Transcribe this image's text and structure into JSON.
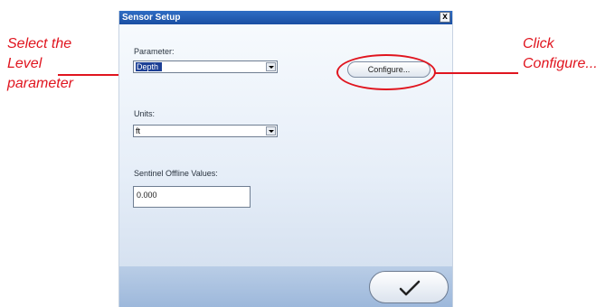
{
  "annotations": {
    "left": [
      "Select the",
      "Level",
      "parameter"
    ],
    "right": [
      "Click",
      "Configure..."
    ]
  },
  "dialog": {
    "title": "Sensor Setup",
    "close_glyph": "x",
    "parameter_label": "Parameter:",
    "parameter_value": "Depth",
    "configure_label": "Configure...",
    "units_label": "Units:",
    "units_value": "ft",
    "offline_label": "Sentinel Offline Values:",
    "offline_value": "0.000",
    "ok_icon": "checkmark-icon"
  },
  "colors": {
    "annotation": "#e0151f",
    "titlebar": "#2f6dc4",
    "selection": "#1c3f95"
  }
}
